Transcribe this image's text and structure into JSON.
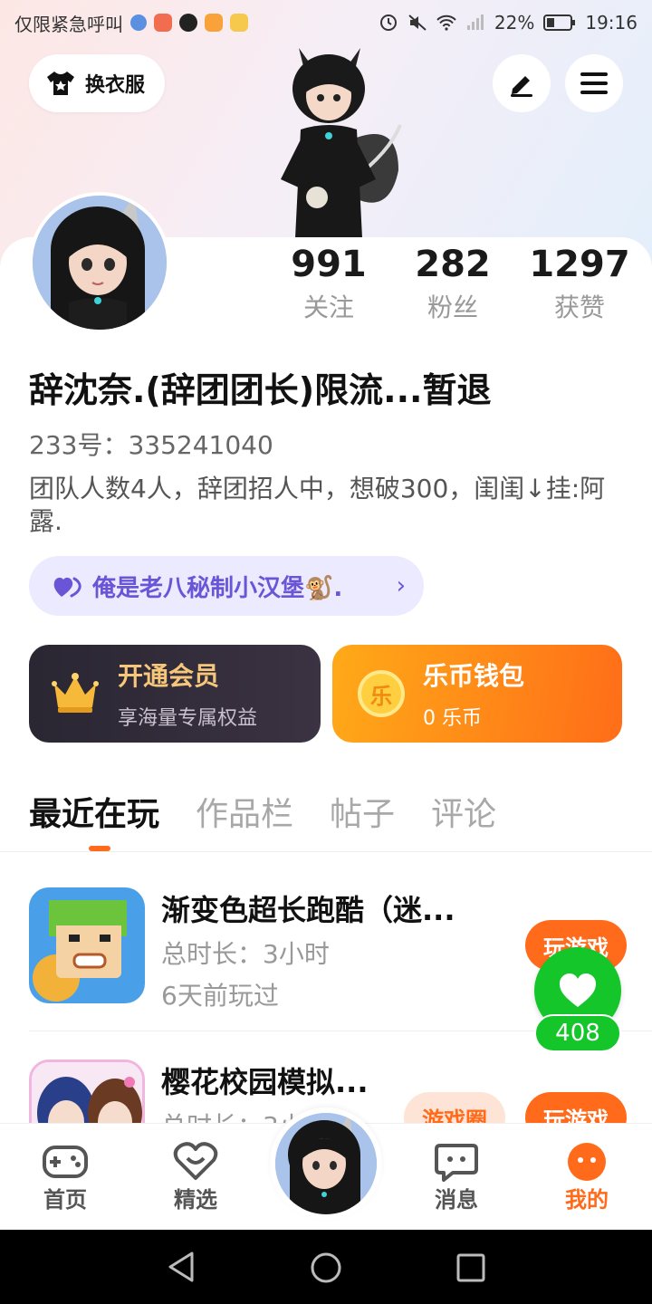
{
  "status_bar": {
    "carrier_text": "仅限紧急呼叫",
    "battery": "22%",
    "time": "19:16"
  },
  "header": {
    "dressup_label": "换衣服"
  },
  "profile": {
    "stats": [
      {
        "value": "991",
        "label": "关注"
      },
      {
        "value": "282",
        "label": "粉丝"
      },
      {
        "value": "1297",
        "label": "获赞"
      }
    ],
    "nickname": "辞沈奈.(辞团团长)限流...暂退",
    "uid": "233号：335241040",
    "bio": "团队人数4人，辞团招人中，想破300，闺闺↓挂:阿露.",
    "group_tag": "俺是老八秘制小汉堡🐒."
  },
  "cards": {
    "vip": {
      "title": "开通会员",
      "subtitle": "享海量专属权益"
    },
    "wallet": {
      "title": "乐币钱包",
      "subtitle": "0 乐币",
      "coin_glyph": "乐"
    }
  },
  "tabs": [
    "最近在玩",
    "作品栏",
    "帖子",
    "评论"
  ],
  "games": [
    {
      "title": "渐变色超长跑酷（迷...",
      "duration": "总时长：3小时",
      "last_played": "6天前玩过",
      "play_label": "玩游戏"
    },
    {
      "title": "樱花校园模拟...",
      "duration": "总时长：3小",
      "circle_label": "游戏圈",
      "play_label": "玩游戏"
    }
  ],
  "float_like": {
    "count": "408"
  },
  "bottom_nav": [
    {
      "label": "首页"
    },
    {
      "label": "精选"
    },
    {
      "label": "消息"
    },
    {
      "label": "我的"
    }
  ],
  "colors": {
    "accent": "#ff6b1a",
    "like_green": "#14c62a",
    "group_purple": "#6a55d6"
  }
}
